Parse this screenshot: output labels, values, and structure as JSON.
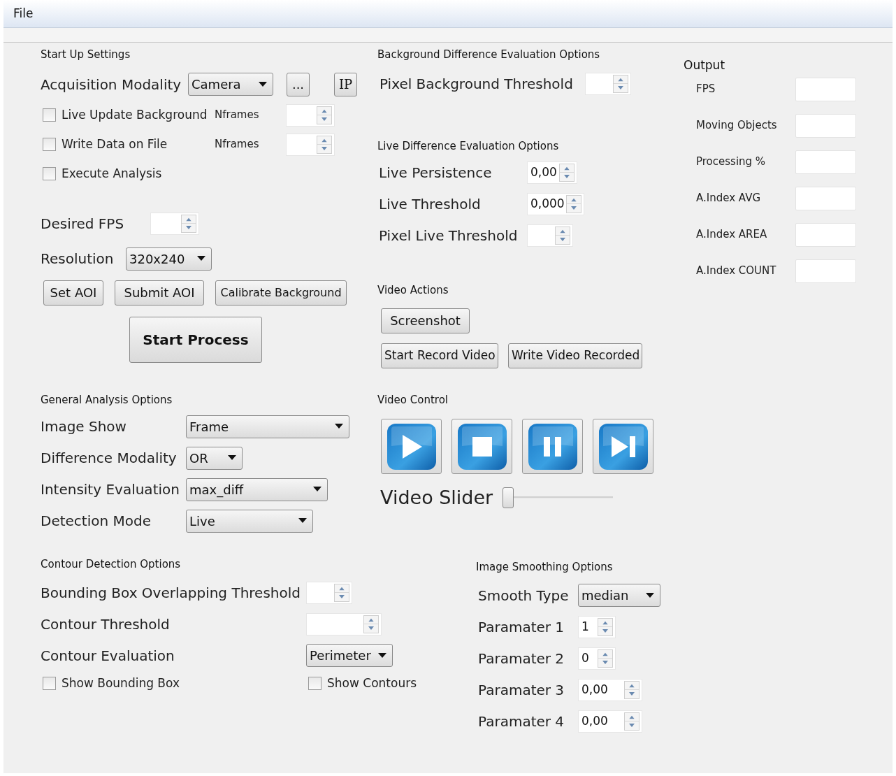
{
  "menu": [
    {
      "label": "File"
    }
  ],
  "startup": {
    "title": "Start Up Settings",
    "acquisition": {
      "label": "Acquisition Modality",
      "value": "Camera"
    },
    "small_buttons": [
      "...",
      "IP"
    ],
    "checks": [
      {
        "label": "Live Update Background",
        "checked": false,
        "spin_label": "Nframes"
      },
      {
        "label": "Write Data on File",
        "checked": false,
        "spin_label": "Nframes"
      },
      {
        "label": "Execute Analysis",
        "checked": false
      }
    ],
    "desired_fps": {
      "label": "Desired FPS"
    },
    "resolution": {
      "label": "Resolution",
      "value": "320x240"
    },
    "aoi_buttons": [
      "Set AOI",
      "Submit AOI",
      "Calibrate Background"
    ],
    "start_button": "Start Process"
  },
  "general": {
    "title": "General Analysis Options",
    "rows": [
      {
        "label": "Image Show",
        "value": "Frame"
      },
      {
        "label": "Difference Modality",
        "value": "OR"
      },
      {
        "label": "Intensity Evaluation",
        "value": "max_diff"
      },
      {
        "label": "Detection Mode",
        "value": "Live"
      }
    ]
  },
  "contour": {
    "title": "Contour Detection Options",
    "rows": [
      {
        "kind": "spin",
        "label": "Bounding Box Overlapping Threshold"
      },
      {
        "kind": "spin",
        "label": "Contour Threshold"
      },
      {
        "kind": "combo",
        "label": "Contour Evaluation",
        "value": "Perimeter"
      }
    ],
    "checks": [
      {
        "label": "Show Bounding Box",
        "checked": false
      },
      {
        "label": "Show Contours",
        "checked": false
      }
    ]
  },
  "background": {
    "title": "Background Difference Evaluation Options",
    "rows": [
      {
        "label": "Pixel Background Threshold"
      }
    ]
  },
  "live": {
    "title": "Live Difference Evaluation Options",
    "rows": [
      {
        "label": "Live Persistence",
        "value": "0,00"
      },
      {
        "label": "Live Threshold",
        "value": "0,000"
      },
      {
        "label": "Pixel Live Threshold"
      }
    ]
  },
  "video_actions": {
    "title": "Video Actions",
    "buttons": [
      "Screenshot",
      "Start Record Video",
      "Write Video Recorded"
    ]
  },
  "video_control": {
    "title": "Video Control",
    "buttons": [
      {
        "kind": "play"
      },
      {
        "kind": "stop"
      },
      {
        "kind": "pause"
      },
      {
        "kind": "next"
      }
    ],
    "slider": {
      "label": "Video Slider",
      "level": 0
    }
  },
  "output": {
    "title": "Output",
    "fields": [
      {
        "label": "FPS"
      },
      {
        "label": "Moving Objects"
      },
      {
        "label": "Processing %"
      },
      {
        "label": "A.Index AVG"
      },
      {
        "label": "A.Index AREA"
      },
      {
        "label": "A.Index COUNT"
      }
    ]
  },
  "smoothing": {
    "title": "Image Smoothing Options",
    "rows": [
      {
        "kind": "combo",
        "label": "Smooth Type",
        "value": "median"
      },
      {
        "kind": "spin",
        "label": "Paramater 1",
        "value": "1"
      },
      {
        "kind": "spin",
        "label": "Paramater 2",
        "value": "0"
      },
      {
        "kind": "spin",
        "label": "Paramater 3",
        "value": "0,00"
      },
      {
        "kind": "spin",
        "label": "Paramater 4",
        "value": "0,00"
      }
    ]
  }
}
